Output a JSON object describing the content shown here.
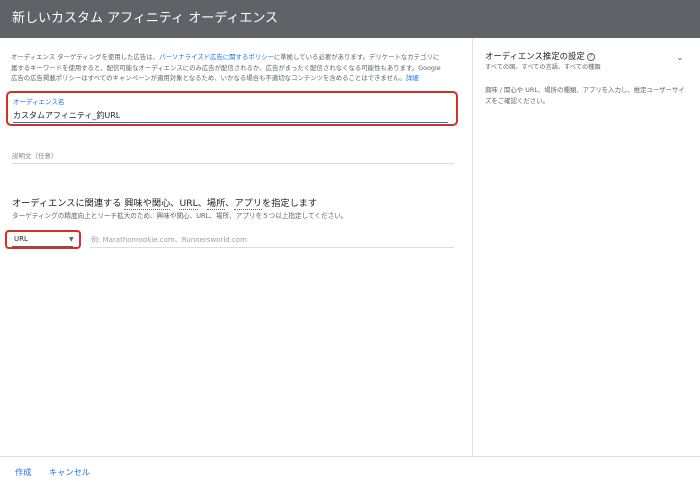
{
  "header": {
    "title": "新しいカスタム アフィニティ オーディエンス"
  },
  "policy": {
    "line1_a": "オーディエンス ターゲティングを使用した広告は、",
    "link_policy": "パーソナライズド広告に関するポリシー",
    "line1_b": "に準拠している必要があります。デリケートなカテゴリに",
    "line2": "属するキーワードを使用すると、配信可能なオーディエンスにのみ広告が配信されるか、広告がまったく配信されなくなる可能性もあります。Google",
    "line3": "広告の広告掲載ポリシーはすべてのキャンペーンが適用対象となるため、いかなる場合も不適切なコンテンツを含めることはできません。",
    "link_details": "詳細"
  },
  "audience_name": {
    "label": "オーディエンス名",
    "value": "カスタムアフィニティ_釣URL"
  },
  "description": {
    "placeholder": "説明文（任意）"
  },
  "targeting": {
    "title_prefix": "オーディエンスに関連する ",
    "title_interests": "興味や関心",
    "title_sep1": "、",
    "title_url": "URL",
    "title_sep2": "、",
    "title_place": "場所",
    "title_sep3": "、",
    "title_apps": "アプリ",
    "title_suffix": "を指定します",
    "subtitle": "ターゲティングの精度向上とリーチ拡大のため、興味や関心、URL、場所、アプリを５つ以上指定してください。",
    "type_select_value": "URL",
    "input_placeholder": "例: Marathonrookie.com、Runnersworld.com"
  },
  "side_panel": {
    "title": "オーディエンス推定の設定",
    "subtitle": "すべての国、すべての言語、すべての種類",
    "description": "興味 / 関心や URL、場所の種類、アプリを入力し、推定ユーザーサイズをご確認ください。"
  },
  "footer": {
    "create_label": "作成",
    "cancel_label": "キャンセル"
  },
  "colors": {
    "header_bg": "#5f6368",
    "link": "#1a73e8",
    "highlight": "#d93025"
  },
  "icons": {
    "help": "help-icon",
    "dropdown": "dropdown-arrow-icon",
    "expand": "chevron-down-icon"
  }
}
